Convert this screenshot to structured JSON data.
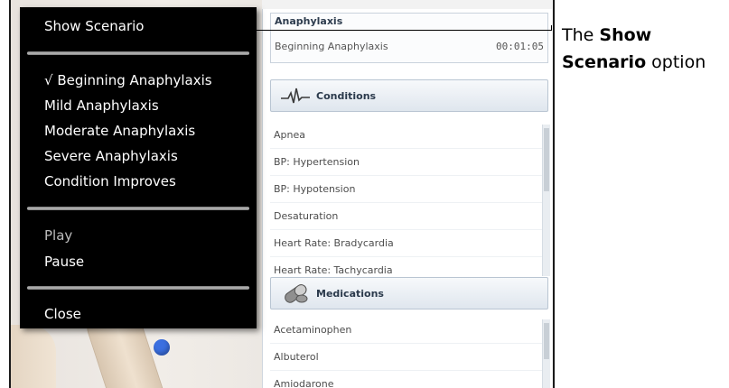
{
  "menu": {
    "show_scenario": "Show Scenario",
    "scenario_items": [
      {
        "label": "√ Beginning Anaphylaxis"
      },
      {
        "label": "Mild Anaphylaxis"
      },
      {
        "label": "Moderate Anaphylaxis"
      },
      {
        "label": "Severe Anaphylaxis"
      },
      {
        "label": "Condition Improves"
      }
    ],
    "play": "Play",
    "pause": "Pause",
    "close": "Close"
  },
  "scenario": {
    "title": "Anaphylaxis",
    "current_state": "Beginning Anaphylaxis",
    "elapsed": "00:01:05"
  },
  "conditions": {
    "heading": "Conditions",
    "icon": "ecg-waveform-icon",
    "items": [
      "Apnea",
      "BP: Hypertension",
      "BP: Hypotension",
      "Desaturation",
      "Heart Rate: Bradycardia",
      "Heart Rate: Tachycardia"
    ]
  },
  "medications": {
    "heading": "Medications",
    "icon": "pill-icon",
    "items": [
      "Acetaminophen",
      "Albuterol",
      "Amiodarone"
    ]
  },
  "callout": {
    "prefix": "The ",
    "bold": "Show Scenario",
    "suffix": " option"
  },
  "colors": {
    "menu_bg": "#000000",
    "marker": "#3b6fe0"
  }
}
